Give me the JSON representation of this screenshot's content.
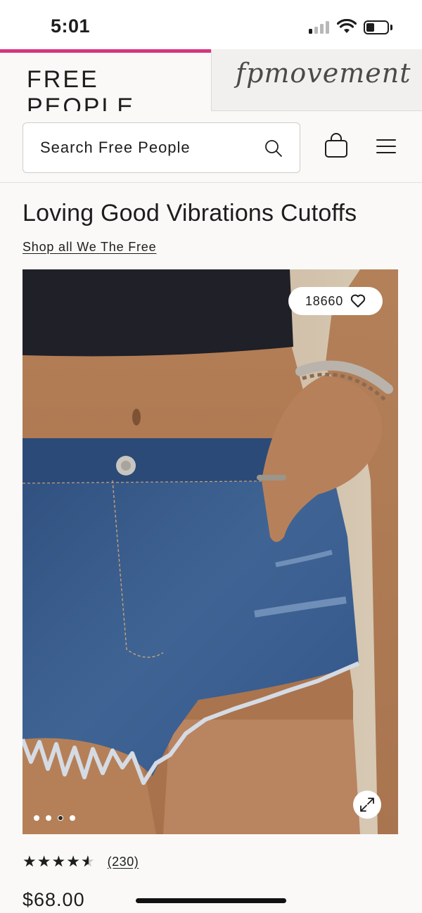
{
  "status_bar": {
    "time": "5:01",
    "signal_bars_active": 1,
    "battery_level": 0.3
  },
  "header": {
    "brand_logo": "FREE PEOPLE",
    "secondary_brand_logo": "fpmovement",
    "search": {
      "placeholder": "Search Free People"
    },
    "icons": {
      "search": "search-icon",
      "bag": "shopping-bag-icon",
      "menu": "hamburger-menu-icon"
    }
  },
  "product": {
    "title": "Loving Good Vibrations Cutoffs",
    "shop_link": "Shop all We The Free",
    "likes": "18660",
    "gallery": {
      "image_count": 4,
      "active_index": 2
    },
    "rating": {
      "stars": 4.5,
      "max": 5,
      "review_count": "(230)"
    },
    "price": "$68.00"
  },
  "colors": {
    "accent": "#d6357f",
    "background": "#faf9f8",
    "text": "#1d1d1d"
  }
}
